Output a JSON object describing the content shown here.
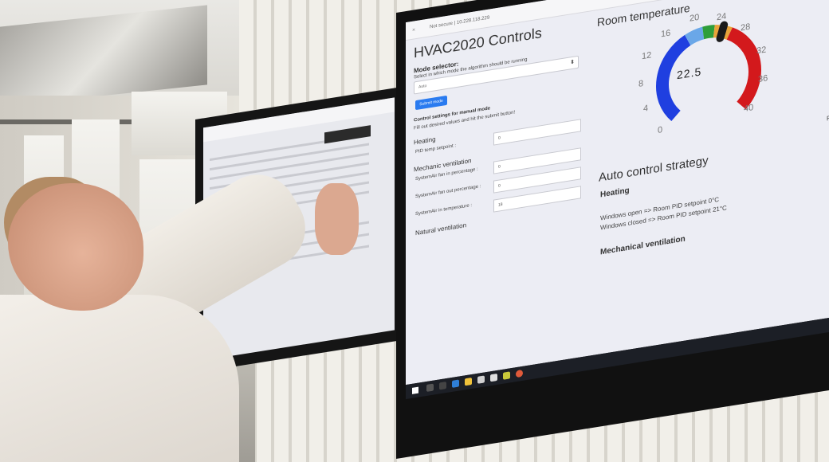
{
  "scene": {
    "description_type": "photo"
  },
  "left_monitor": {
    "bar_color": "#f5f5f7"
  },
  "right_monitor": {
    "browser": {
      "address": "Not secure | 10.228.118.229",
      "tab_label": "×"
    },
    "app": {
      "title": "HVAC2020 Controls",
      "mode_selector_label": "Mode selector:",
      "mode_selector_help": "Select in which mode the algorithm should be running",
      "mode_selector_value": "Auto",
      "submit_label": "Submit mode",
      "manual_heading": "Control settings for manual mode",
      "manual_help": "Fill out desired values and hit the submit button!",
      "heating_heading": "Heating",
      "pid_label": "PID temp setpoint :",
      "pid_value": "0",
      "mechanic_heading": "Mechanic ventilation",
      "fan_in_label": "SystemAir fan in percentage :",
      "fan_in_value": "0",
      "fan_out_label": "SystemAir fan out percentage :",
      "fan_out_value": "0",
      "air_in_temp_label": "SystemAir in temperature :",
      "air_in_temp_value": "18",
      "natural_heading": "Natural ventilation"
    },
    "room": {
      "title": "Room temperature",
      "value": "22.5",
      "ticks": [
        "0",
        "4",
        "8",
        "12",
        "16",
        "20",
        "24",
        "28",
        "32",
        "36",
        "40"
      ],
      "gauge_value": 22.5,
      "gauge_min": 0,
      "gauge_max": 40,
      "colors": {
        "cold": "#1f3fe0",
        "light_blue": "#6aa7e8",
        "green": "#2e9e3a",
        "warm": "#e8a43a",
        "hot": "#d3191c",
        "needle": "#1a1a1a"
      }
    },
    "auto": {
      "title": "Auto control strategy",
      "heating": "Heating",
      "windows_open": "Windows open => Room PID setpoint 0°C",
      "windows_closed": "Windows closed => Room PID setpoint 21°C",
      "mechanical": "Mechanical ventilation",
      "edge_text": "Po"
    }
  }
}
